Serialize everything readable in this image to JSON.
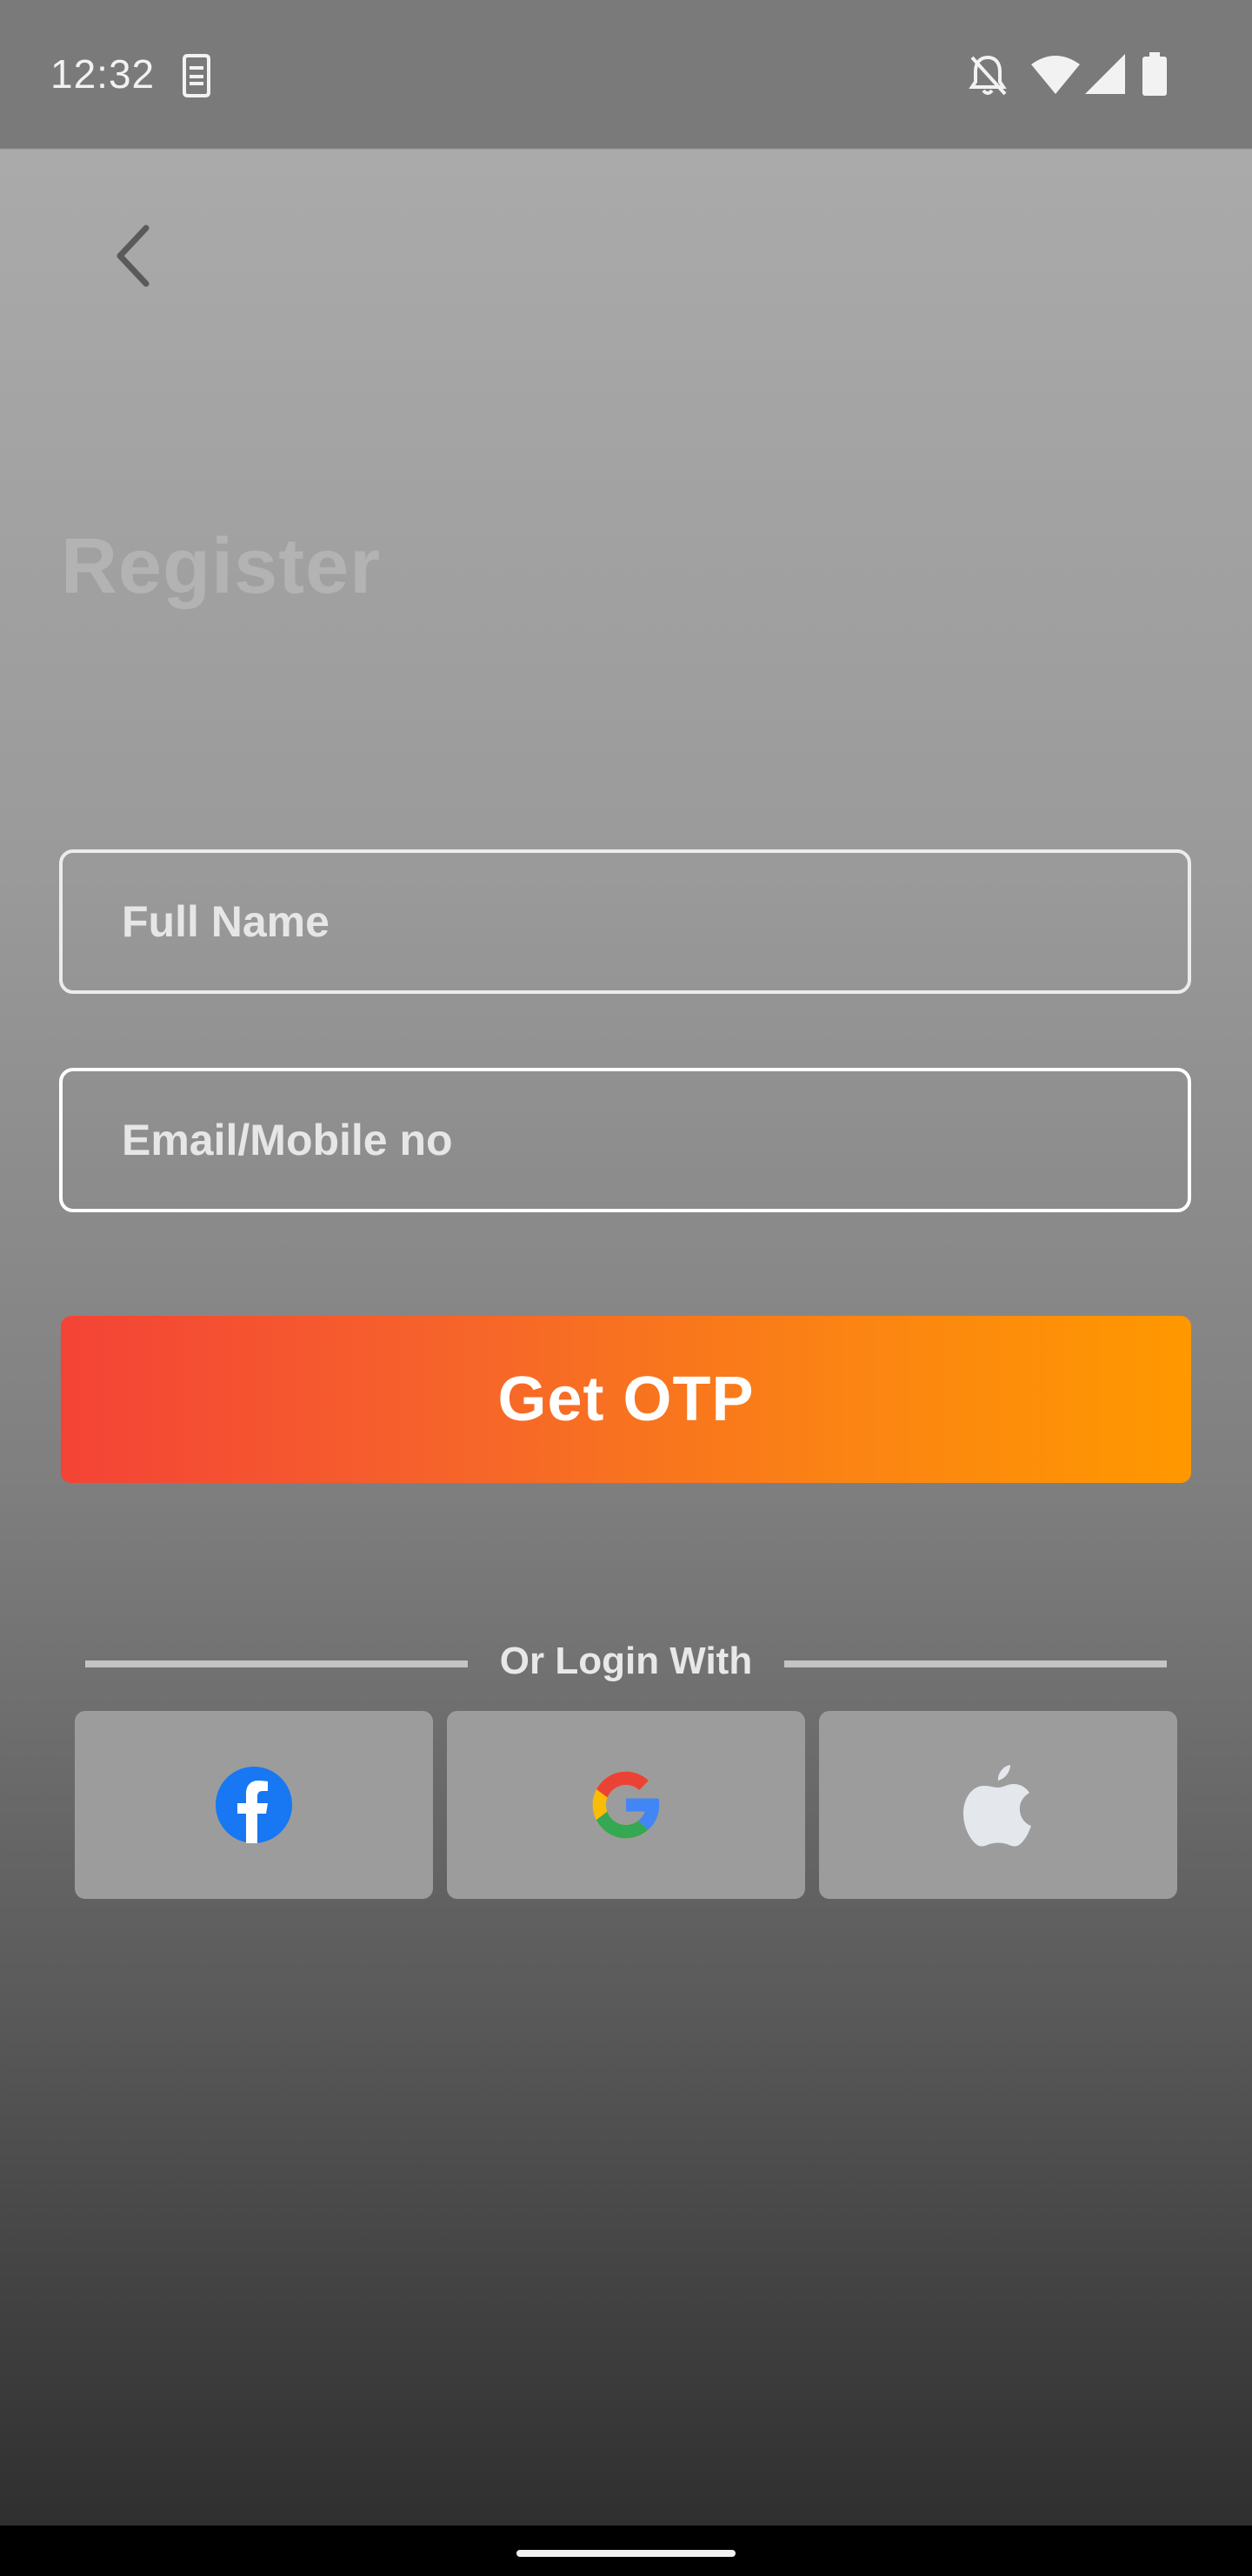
{
  "status_bar": {
    "time": "12:32",
    "icons": [
      "sim-card-icon",
      "notifications-off-icon",
      "wifi-icon",
      "signal-icon",
      "battery-icon"
    ]
  },
  "header": {
    "back_icon": "chevron-left-icon"
  },
  "title": "Register",
  "form": {
    "full_name": {
      "value": "",
      "placeholder": "Full Name"
    },
    "email_mobile": {
      "value": "",
      "placeholder": "Email/Mobile no"
    },
    "submit_label": "Get OTP"
  },
  "social": {
    "divider_label": "Or Login With",
    "buttons": [
      {
        "name": "facebook",
        "icon": "facebook-icon"
      },
      {
        "name": "google",
        "icon": "google-icon"
      },
      {
        "name": "apple",
        "icon": "apple-icon"
      }
    ]
  },
  "colors": {
    "button_gradient_start": "#f44336",
    "button_gradient_end": "#ff9800",
    "facebook_blue": "#1877f2",
    "google_blue": "#4285f4",
    "google_red": "#ea4335",
    "google_yellow": "#fbbc05",
    "google_green": "#34a853"
  }
}
